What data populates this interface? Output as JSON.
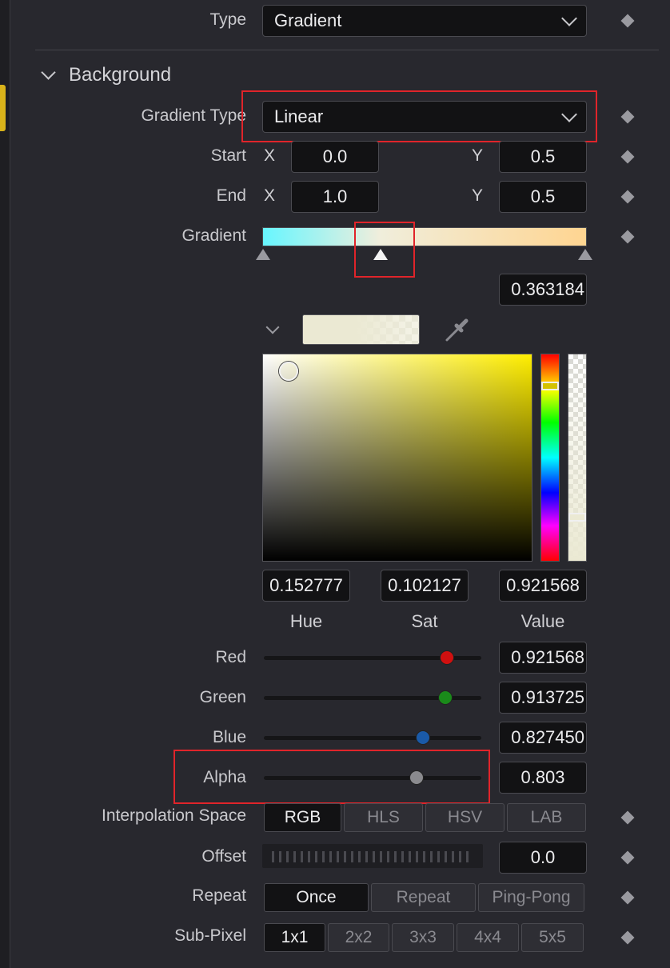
{
  "type_row": {
    "label": "Type",
    "value": "Gradient"
  },
  "background_section": {
    "title": "Background"
  },
  "gradient_type": {
    "label": "Gradient Type",
    "value": "Linear"
  },
  "start": {
    "label": "Start",
    "x_label": "X",
    "x": "0.0",
    "y_label": "Y",
    "y": "0.5"
  },
  "end": {
    "label": "End",
    "x_label": "X",
    "x": "1.0",
    "y_label": "Y",
    "y": "0.5"
  },
  "gradient": {
    "label": "Gradient",
    "stop_position": "0.363184",
    "start_color": "#67f6ff",
    "end_color": "#ffd591"
  },
  "color_picker": {
    "swatch_color": "#ebe9d3",
    "hue": "0.152777",
    "sat": "0.102127",
    "value": "0.921568",
    "hue_label": "Hue",
    "sat_label": "Sat",
    "value_label": "Value"
  },
  "channels": [
    {
      "label": "Red",
      "value": "0.921568",
      "level": 0.92,
      "color": "#d01010"
    },
    {
      "label": "Green",
      "value": "0.913725",
      "level": 0.91,
      "color": "#1a8a1a"
    },
    {
      "label": "Blue",
      "value": "0.827450",
      "level": 0.81,
      "color": "#1a5aa8"
    },
    {
      "label": "Alpha",
      "value": "0.803",
      "level": 0.78,
      "color": "#8a8a8e"
    }
  ],
  "interpolation": {
    "label": "Interpolation Space",
    "options": [
      "RGB",
      "HLS",
      "HSV",
      "LAB"
    ],
    "selected": "RGB"
  },
  "offset": {
    "label": "Offset",
    "value": "0.0"
  },
  "repeat": {
    "label": "Repeat",
    "options": [
      "Once",
      "Repeat",
      "Ping-Pong"
    ],
    "selected": "Once"
  },
  "subpixel": {
    "label": "Sub-Pixel",
    "options": [
      "1x1",
      "2x2",
      "3x3",
      "4x4",
      "5x5"
    ],
    "selected": "1x1"
  }
}
